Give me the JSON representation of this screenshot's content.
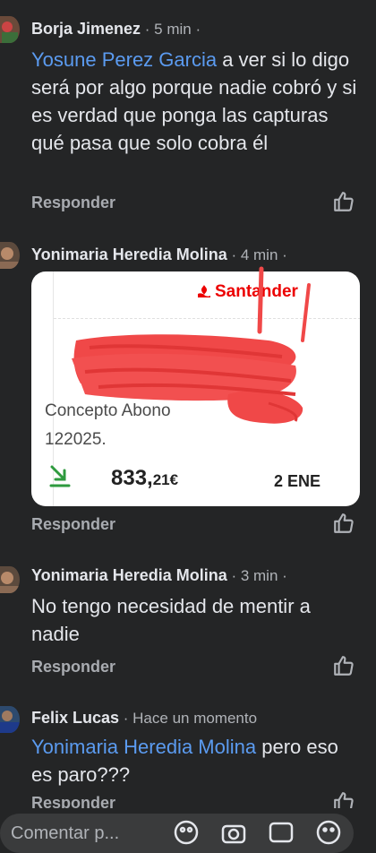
{
  "comments": [
    {
      "author": "Borja Jimenez",
      "time": " · 5 min ·",
      "mention": "Yosune Perez Garcia",
      "text": " a ver si lo digo será por algo porque nadie cobró y si es verdad que ponga las capturas qué pasa que solo cobra él",
      "reply_label": "Responder"
    },
    {
      "author": "Yonimaria Heredia Molina",
      "time": " · 4 min ·",
      "reply_label": "Responder",
      "attachment": {
        "brand": "Santander",
        "concept_line1": "Concepto Abono",
        "concept_line2": "122025.",
        "amount_main": "833,",
        "amount_cents": "21€",
        "date": "2 ENE"
      }
    },
    {
      "author": "Yonimaria Heredia Molina",
      "time": " · 3 min ·",
      "text": "No tengo necesidad de mentir a nadie",
      "reply_label": "Responder"
    },
    {
      "author": "Felix Lucas",
      "time": " · Hace un momento",
      "mention": "Yonimaria Heredia Molina",
      "text": " pero eso es paro???",
      "reply_label": "Responder"
    }
  ],
  "composer": {
    "placeholder": "Comentar p..."
  },
  "colors": {
    "background": "#242526",
    "mention": "#5b9bf0",
    "santander_red": "#ec0000",
    "scribble_red": "#f04848"
  },
  "icons": [
    "like-icon",
    "santander-flame-icon",
    "incoming-transfer-icon",
    "sticker-icon",
    "camera-icon",
    "gif-icon",
    "emoji-icon"
  ]
}
